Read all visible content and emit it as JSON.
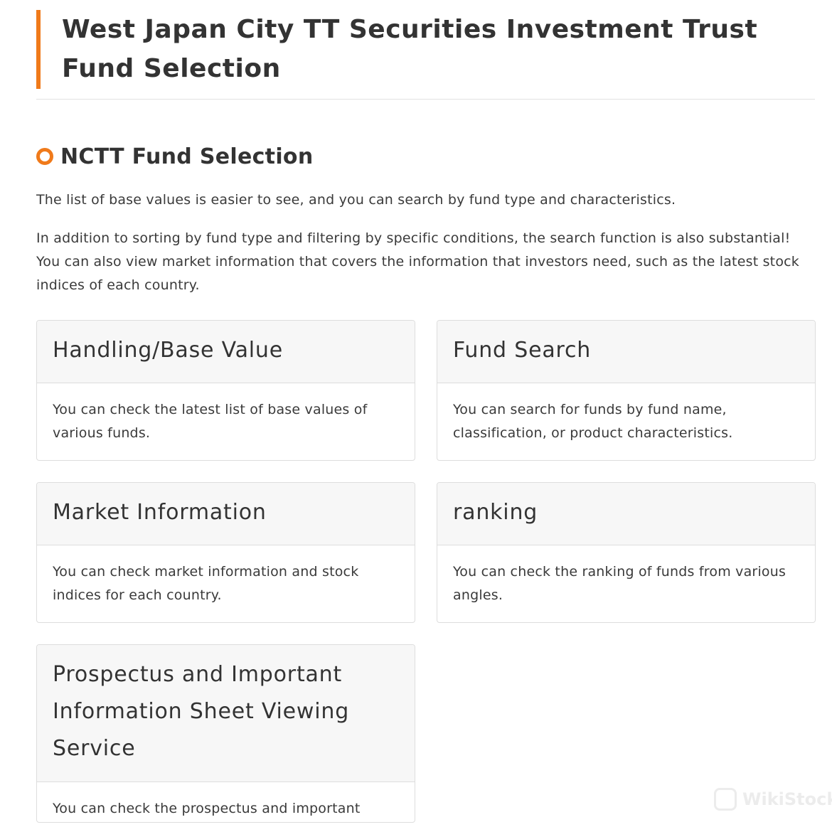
{
  "header": {
    "title": "West Japan City TT Securities Investment Trust Fund Selection",
    "accent_color": "#f07a1a"
  },
  "section": {
    "icon": "circle-icon",
    "title": "NCTT Fund Selection",
    "intro_1": "The list of base values is easier to see, and you can search by fund type and characteristics.",
    "intro_2": "In addition to sorting by fund type and filtering by specific conditions, the search function is also substantial! You can also view market information that covers the information that investors need, such as the latest stock indices of each country."
  },
  "cards": [
    {
      "title": "Handling/Base Value",
      "description": "You can check the latest list of base values of various funds."
    },
    {
      "title": "Fund Search",
      "description": "You can search for funds by fund name, classification, or product characteristics."
    },
    {
      "title": "Market Information",
      "description": "You can check market information and stock indices for each country."
    },
    {
      "title": "ranking",
      "description": "You can check the ranking of funds from various angles."
    },
    {
      "title": "Prospectus and Important Information Sheet Viewing Service",
      "description": "You can check the prospectus and important"
    }
  ],
  "watermark": {
    "text": "WikiStock",
    "icon": "wikistock-logo-icon"
  }
}
